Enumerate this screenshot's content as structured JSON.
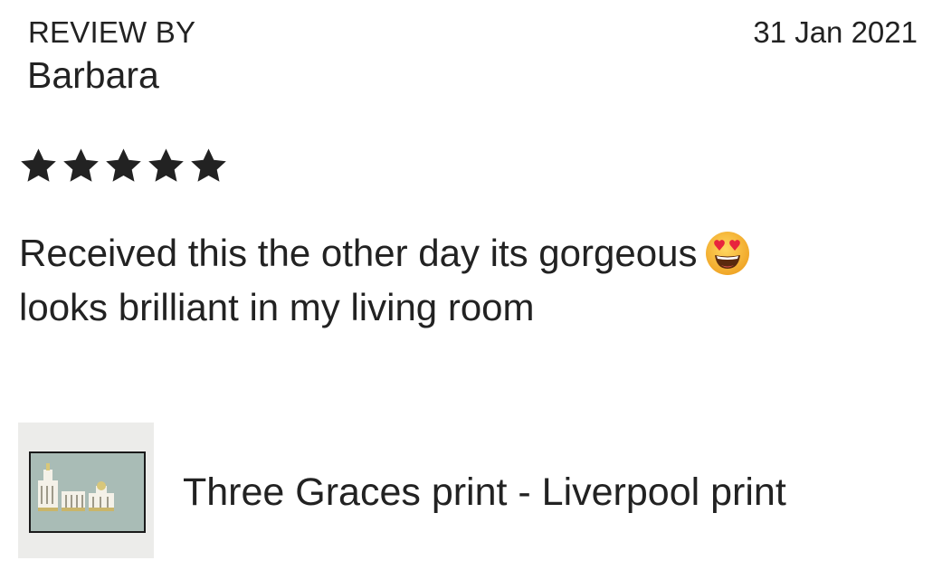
{
  "review": {
    "label": "REVIEW BY",
    "reviewer": "Barbara",
    "date": "31 Jan 2021",
    "rating": 5,
    "rating_max": 5,
    "text_line1": "Received this the other day its gorgeous",
    "text_line2": "looks brilliant in my living room",
    "emoji": "heart-eyes-emoji"
  },
  "product": {
    "title": "Three Graces print - Liverpool print",
    "thumbnail": "framed-print-thumbnail"
  },
  "colors": {
    "text": "#222222",
    "star": "#222222",
    "emoji_face": "#f7b733",
    "emoji_heart": "#e8243d",
    "print_background": "#a9bcb6"
  }
}
